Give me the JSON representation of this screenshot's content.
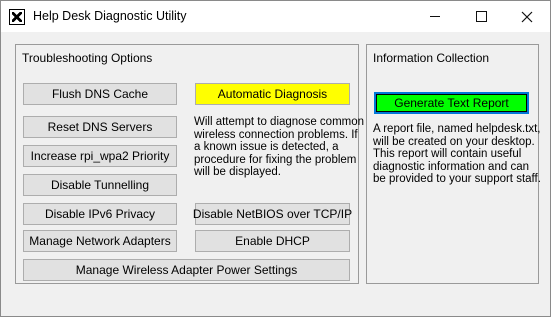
{
  "window": {
    "title": "Help Desk Diagnostic Utility",
    "controls": {
      "minimize": "minimize",
      "maximize": "maximize",
      "close": "close"
    }
  },
  "troubleshooting": {
    "label": "Troubleshooting Options",
    "flush_dns": "Flush DNS Cache",
    "automatic_diagnosis": "Automatic Diagnosis",
    "reset_dns": "Reset DNS Servers",
    "increase_priority": "Increase rpi_wpa2 Priority",
    "disable_tunnelling": "Disable Tunnelling",
    "disable_ipv6": "Disable IPv6 Privacy",
    "disable_netbios": "Disable NetBIOS over TCP/IP",
    "manage_adapters": "Manage Network Adapters",
    "enable_dhcp": "Enable DHCP",
    "manage_power": "Manage Wireless Adapter Power Settings",
    "auto_description": [
      "Will attempt to diagnose common",
      "wireless connection problems. If",
      "a known issue is detected, a",
      "procedure for fixing the problem",
      "will be displayed."
    ]
  },
  "information": {
    "label": "Information Collection",
    "generate_report": "Generate Text Report",
    "report_description": [
      "A report file, named helpdesk.txt,",
      "will be created on your desktop.",
      "This report will contain useful",
      "diagnostic information and can",
      "be provided to your support staff."
    ]
  },
  "colors": {
    "automatic_diagnosis_bg": "#ffff00",
    "generate_report_bg": "#00ff00",
    "focus_border": "#0078d7"
  }
}
